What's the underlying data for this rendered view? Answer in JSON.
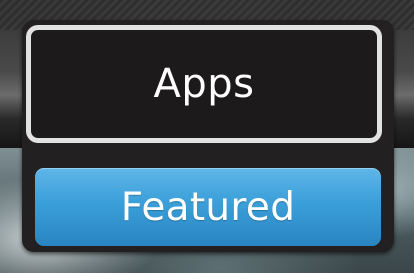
{
  "flyout": {
    "items": [
      {
        "label": "Apps",
        "state": "focused"
      },
      {
        "label": "Featured",
        "state": "selected"
      }
    ]
  },
  "colors": {
    "panel_background": "#232021",
    "focus_border": "#e2e2e2",
    "selected_accent": "#3a9fd9",
    "label_text": "#ffffff"
  }
}
